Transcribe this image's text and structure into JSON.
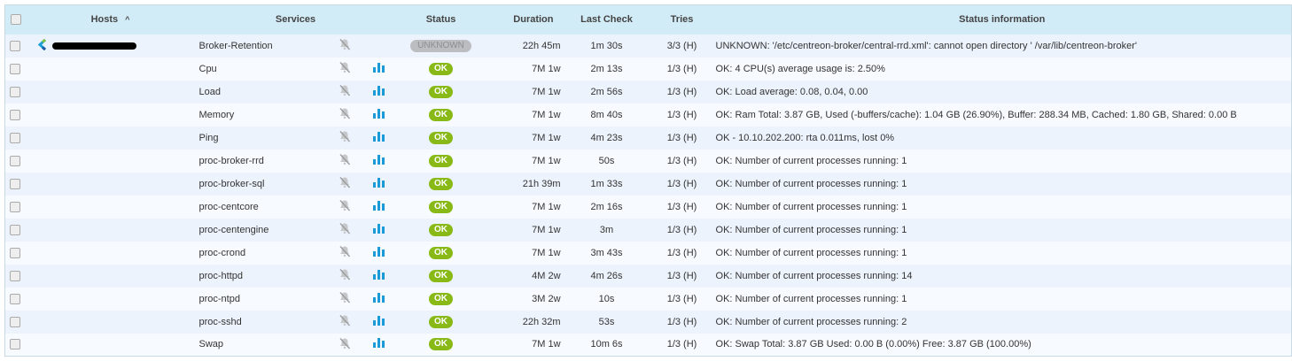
{
  "header": {
    "hosts": "Hosts",
    "services": "Services",
    "status": "Status",
    "duration": "Duration",
    "last_check": "Last Check",
    "tries": "Tries",
    "status_info": "Status information"
  },
  "colors": {
    "ok": "#88b917",
    "unknown": "#bcbdc0",
    "header_bg": "#d2ecf7",
    "graph": "#1a9ad6"
  },
  "rows": [
    {
      "service": "Broker-Retention",
      "status": "UNKNOWN",
      "duration": "22h 45m",
      "last_check": "1m 30s",
      "tries": "3/3 (H)",
      "info": "UNKNOWN: '/etc/centreon-broker/central-rrd.xml': cannot open directory ' /var/lib/centreon-broker'"
    },
    {
      "service": "Cpu",
      "status": "OK",
      "duration": "7M 1w",
      "last_check": "2m 13s",
      "tries": "1/3 (H)",
      "info": "OK: 4 CPU(s) average usage is: 2.50%"
    },
    {
      "service": "Load",
      "status": "OK",
      "duration": "7M 1w",
      "last_check": "2m 56s",
      "tries": "1/3 (H)",
      "info": "OK: Load average: 0.08, 0.04, 0.00"
    },
    {
      "service": "Memory",
      "status": "OK",
      "duration": "7M 1w",
      "last_check": "8m 40s",
      "tries": "1/3 (H)",
      "info": "OK: Ram Total: 3.87 GB, Used (-buffers/cache): 1.04 GB (26.90%), Buffer: 288.34 MB, Cached: 1.80 GB, Shared: 0.00 B"
    },
    {
      "service": "Ping",
      "status": "OK",
      "duration": "7M 1w",
      "last_check": "4m 23s",
      "tries": "1/3 (H)",
      "info": "OK - 10.10.202.200: rta 0.011ms, lost 0%"
    },
    {
      "service": "proc-broker-rrd",
      "status": "OK",
      "duration": "7M 1w",
      "last_check": "50s",
      "tries": "1/3 (H)",
      "info": "OK: Number of current processes running: 1"
    },
    {
      "service": "proc-broker-sql",
      "status": "OK",
      "duration": "21h 39m",
      "last_check": "1m 33s",
      "tries": "1/3 (H)",
      "info": "OK: Number of current processes running: 1"
    },
    {
      "service": "proc-centcore",
      "status": "OK",
      "duration": "7M 1w",
      "last_check": "2m 16s",
      "tries": "1/3 (H)",
      "info": "OK: Number of current processes running: 1"
    },
    {
      "service": "proc-centengine",
      "status": "OK",
      "duration": "7M 1w",
      "last_check": "3m",
      "tries": "1/3 (H)",
      "info": "OK: Number of current processes running: 1"
    },
    {
      "service": "proc-crond",
      "status": "OK",
      "duration": "7M 1w",
      "last_check": "3m 43s",
      "tries": "1/3 (H)",
      "info": "OK: Number of current processes running: 1"
    },
    {
      "service": "proc-httpd",
      "status": "OK",
      "duration": "4M 2w",
      "last_check": "4m 26s",
      "tries": "1/3 (H)",
      "info": "OK: Number of current processes running: 14"
    },
    {
      "service": "proc-ntpd",
      "status": "OK",
      "duration": "3M 2w",
      "last_check": "10s",
      "tries": "1/3 (H)",
      "info": "OK: Number of current processes running: 1"
    },
    {
      "service": "proc-sshd",
      "status": "OK",
      "duration": "22h 32m",
      "last_check": "53s",
      "tries": "1/3 (H)",
      "info": "OK: Number of current processes running: 2"
    },
    {
      "service": "Swap",
      "status": "OK",
      "duration": "7M 1w",
      "last_check": "10m 6s",
      "tries": "1/3 (H)",
      "info": "OK: Swap Total: 3.87 GB Used: 0.00 B (0.00%) Free: 3.87 GB (100.00%)"
    }
  ]
}
